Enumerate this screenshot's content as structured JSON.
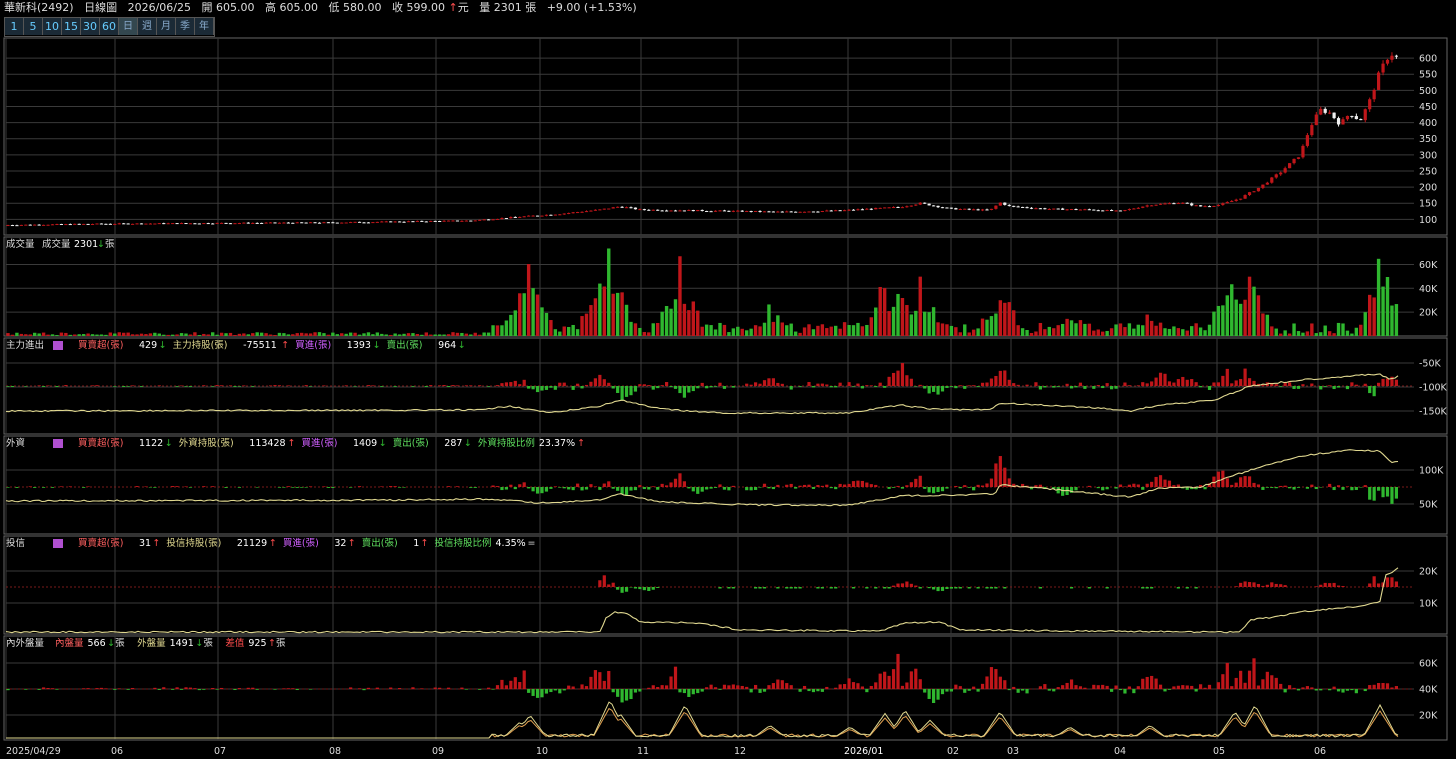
{
  "header": {
    "stock": "華新科(2492)",
    "chart_type": "日線圖",
    "date": "2026/06/25",
    "open": "開 605.00",
    "high": "高 605.00",
    "low": "低 580.00",
    "close": "收 599.00",
    "close_unit": "元",
    "volume": "量 2301 張",
    "change": "+9.00 (+1.53%)"
  },
  "toolbar": {
    "periods": [
      "1",
      "5",
      "10",
      "15",
      "30",
      "60",
      "日",
      "週",
      "月",
      "季",
      "年"
    ],
    "active": "日"
  },
  "colors": {
    "up": "#c0161a",
    "down": "#2fb72f",
    "grid": "#3a3a3a",
    "panel_border": "#666666",
    "line_yellow": "#e0d890",
    "line_orange": "#e0a050"
  },
  "chart_data": [
    {
      "type": "candlestick",
      "panel": "price",
      "x_labels": [
        "2025/04/29",
        "06",
        "07",
        "08",
        "09",
        "10",
        "11",
        "12",
        "2026/01",
        "02",
        "03",
        "04",
        "05",
        "06"
      ],
      "y_ticks": [
        "100",
        "150",
        "200",
        "250",
        "300",
        "350",
        "400",
        "450",
        "500",
        "550",
        "600"
      ],
      "ylim": [
        70,
        650
      ],
      "last": {
        "date": "2026/06/25",
        "open": 605.0,
        "high": 605.0,
        "low": 580.0,
        "close": 599.0
      },
      "close_anchors": [
        [
          0,
          82
        ],
        [
          100,
          86
        ],
        [
          200,
          88
        ],
        [
          330,
          90
        ],
        [
          470,
          96
        ],
        [
          500,
          103
        ],
        [
          520,
          108
        ],
        [
          560,
          117
        ],
        [
          600,
          130
        ],
        [
          620,
          140
        ],
        [
          640,
          130
        ],
        [
          680,
          128
        ],
        [
          720,
          126
        ],
        [
          780,
          123
        ],
        [
          840,
          127
        ],
        [
          900,
          138
        ],
        [
          920,
          150
        ],
        [
          950,
          133
        ],
        [
          990,
          128
        ],
        [
          1000,
          152
        ],
        [
          1010,
          140
        ],
        [
          1050,
          132
        ],
        [
          1090,
          130
        ],
        [
          1120,
          125
        ],
        [
          1150,
          145
        ],
        [
          1180,
          152
        ],
        [
          1200,
          140
        ],
        [
          1220,
          145
        ],
        [
          1240,
          165
        ],
        [
          1260,
          200
        ],
        [
          1280,
          245
        ],
        [
          1300,
          300
        ],
        [
          1310,
          385
        ],
        [
          1320,
          440
        ],
        [
          1330,
          430
        ],
        [
          1340,
          395
        ],
        [
          1350,
          430
        ],
        [
          1360,
          405
        ],
        [
          1370,
          470
        ],
        [
          1380,
          560
        ],
        [
          1390,
          615
        ],
        [
          1400,
          599
        ]
      ]
    },
    {
      "type": "bar",
      "panel": "volume",
      "label": "成交量",
      "value_label": "成交量",
      "value": "2301",
      "unit": "張",
      "y_ticks": [
        "20K",
        "40K",
        "60K"
      ],
      "ylim": [
        0,
        78000
      ],
      "spikes": [
        [
          510,
          18000
        ],
        [
          520,
          38000
        ],
        [
          530,
          72000
        ],
        [
          540,
          22000
        ],
        [
          600,
          60000
        ],
        [
          610,
          78000
        ],
        [
          620,
          40000
        ],
        [
          680,
          70000
        ],
        [
          690,
          25000
        ],
        [
          770,
          28000
        ],
        [
          850,
          18000
        ],
        [
          885,
          52000
        ],
        [
          900,
          40000
        ],
        [
          920,
          54000
        ],
        [
          1000,
          46000
        ],
        [
          1070,
          28000
        ],
        [
          1150,
          24000
        ],
        [
          1230,
          64000
        ],
        [
          1250,
          56000
        ],
        [
          1380,
          70000
        ],
        [
          1390,
          40000
        ]
      ]
    },
    {
      "type": "bar+line",
      "panel": "main_force",
      "label": "主力進出",
      "items": [
        {
          "name": "買賣超(張)",
          "value": "429",
          "dir": "down"
        },
        {
          "name": "主力持股(張)",
          "value": "-75511",
          "dir": "up"
        },
        {
          "name": "買進(張)",
          "value": "1393",
          "dir": "down"
        },
        {
          "name": "賣出(張)",
          "value": "964",
          "dir": "down"
        }
      ],
      "y_ticks": [
        "-50K",
        "-100K",
        "-150K"
      ]
    },
    {
      "type": "bar+line",
      "panel": "foreign",
      "label": "外資",
      "items": [
        {
          "name": "買賣超(張)",
          "value": "1122",
          "dir": "down"
        },
        {
          "name": "外資持股(張)",
          "value": "113428",
          "dir": "up"
        },
        {
          "name": "買進(張)",
          "value": "1409",
          "dir": "down"
        },
        {
          "name": "賣出(張)",
          "value": "287",
          "dir": "down"
        },
        {
          "name": "外資持股比例",
          "value": "23.37%",
          "dir": "up"
        }
      ],
      "y_ticks": [
        "50K",
        "100K"
      ]
    },
    {
      "type": "bar+line",
      "panel": "trust",
      "label": "投信",
      "items": [
        {
          "name": "買賣超(張)",
          "value": "31",
          "dir": "up"
        },
        {
          "name": "投信持股(張)",
          "value": "21129",
          "dir": "up"
        },
        {
          "name": "買進(張)",
          "value": "32",
          "dir": "up"
        },
        {
          "name": "賣出(張)",
          "value": "1",
          "dir": "up"
        },
        {
          "name": "投信持股比例",
          "value": "4.35%",
          "dir": "eq"
        }
      ],
      "y_ticks": [
        "10K",
        "20K"
      ]
    },
    {
      "type": "bar+line",
      "panel": "in_out",
      "label": "內外盤量",
      "items": [
        {
          "name": "內盤量",
          "value": "566",
          "unit": "張",
          "dir": "down"
        },
        {
          "name": "外盤量",
          "value": "1491",
          "unit": "張",
          "dir": "down"
        },
        {
          "name": "差值",
          "value": "925",
          "unit": "張",
          "dir": "up"
        }
      ],
      "y_ticks": [
        "20K",
        "40K",
        "60K"
      ]
    }
  ]
}
